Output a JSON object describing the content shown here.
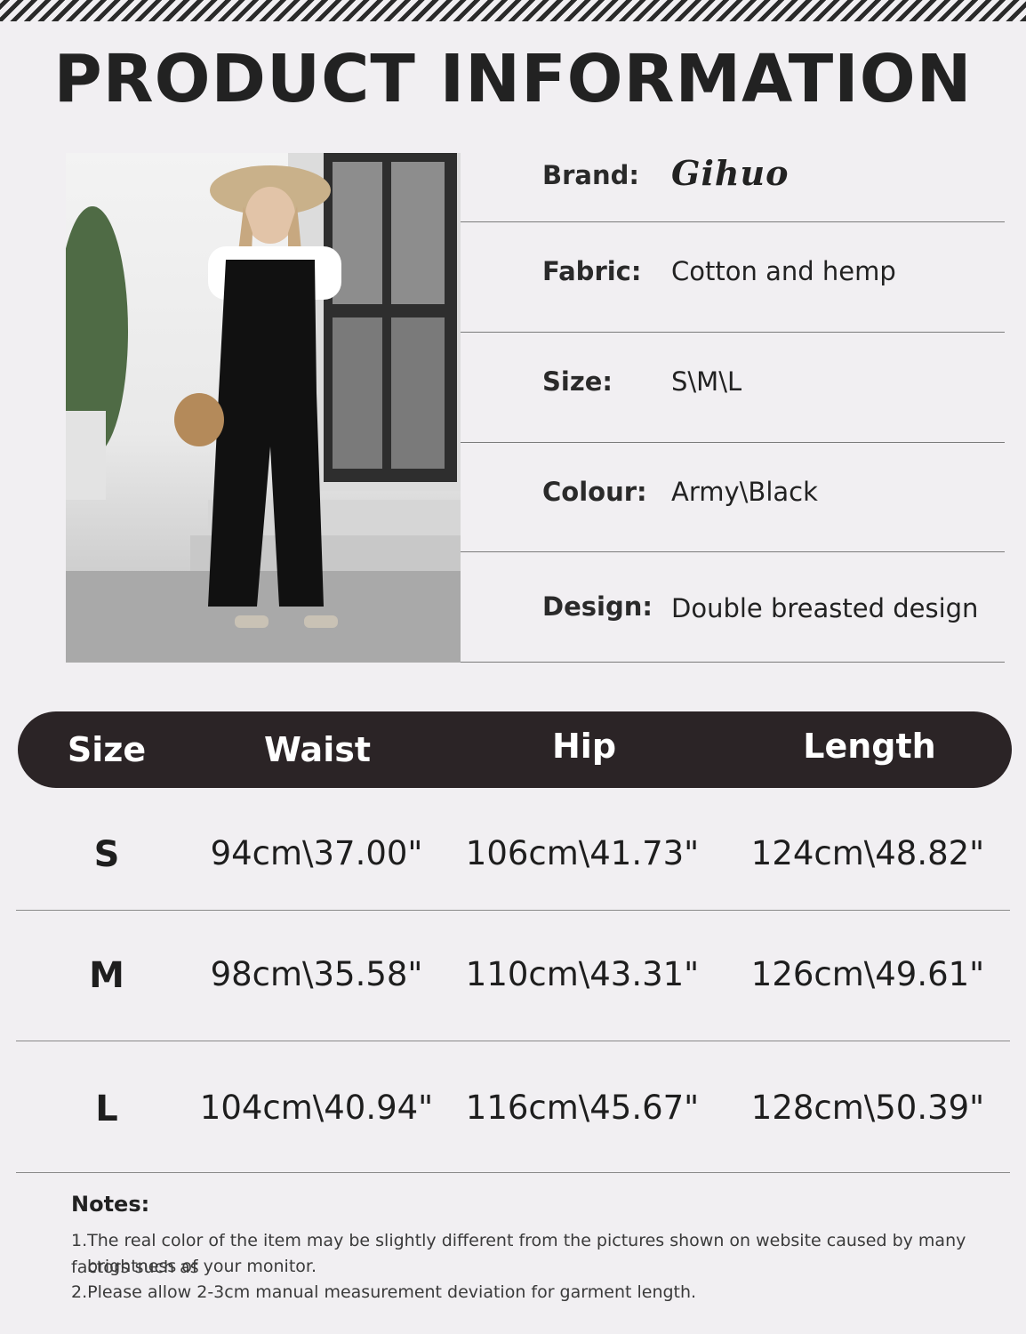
{
  "header": {
    "title": "PRODUCT INFORMATION"
  },
  "info": [
    {
      "label": "Brand:",
      "value": "Gihuo"
    },
    {
      "label": "Fabric:",
      "value": "Cotton and hemp"
    },
    {
      "label": "Size:",
      "value": "S\\M\\L"
    },
    {
      "label": "Colour:",
      "value": "Army\\Black"
    },
    {
      "label": "Design:",
      "value": "Double breasted design"
    }
  ],
  "size_table": {
    "headers": [
      "Size",
      "Waist",
      "Hip",
      "Length"
    ],
    "rows": [
      [
        "S",
        "94cm\\37.00\"",
        "106cm\\41.73\"",
        "124cm\\48.82\""
      ],
      [
        "M",
        "98cm\\35.58\"",
        "110cm\\43.31\"",
        "126cm\\49.61\""
      ],
      [
        "L",
        "104cm\\40.94\"",
        "116cm\\45.67\"",
        "128cm\\50.39\""
      ]
    ]
  },
  "notes": {
    "title": "Notes:",
    "items": [
      "1.The real color of the item may be slightly different from the pictures shown on website caused by many factors such as",
      "brightness of your monitor.",
      "2.Please allow 2-3cm manual measurement deviation for garment length."
    ]
  },
  "colors": {
    "background": "#f1eff2",
    "header_bar": "#2b2426",
    "text": "#1b1b1b"
  }
}
